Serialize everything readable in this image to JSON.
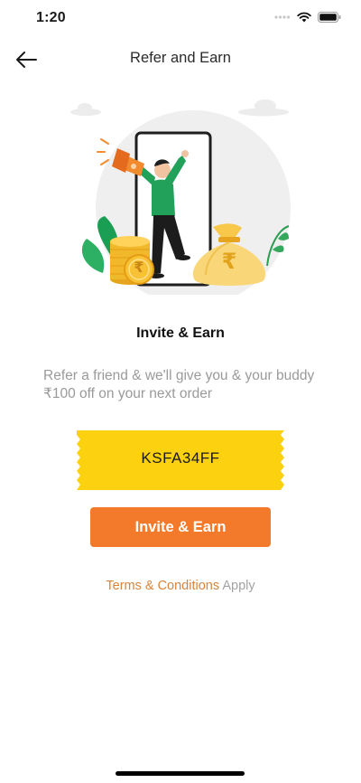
{
  "status_bar": {
    "time": "1:20"
  },
  "nav": {
    "title": "Refer and Earn",
    "back_icon": "arrow-left-icon"
  },
  "content": {
    "heading": "Invite & Earn",
    "description": "Refer a friend & we'll give you & your buddy ₹100 off on your next order",
    "coupon_code": "KSFA34FF",
    "cta_label": "Invite & Earn",
    "terms_link": "Terms & Conditions",
    "terms_suffix": "Apply",
    "coin_symbol": "₹"
  },
  "colors": {
    "accent": "#f27a2a",
    "coupon": "#fcd10f",
    "terms_link": "#d9843a"
  }
}
